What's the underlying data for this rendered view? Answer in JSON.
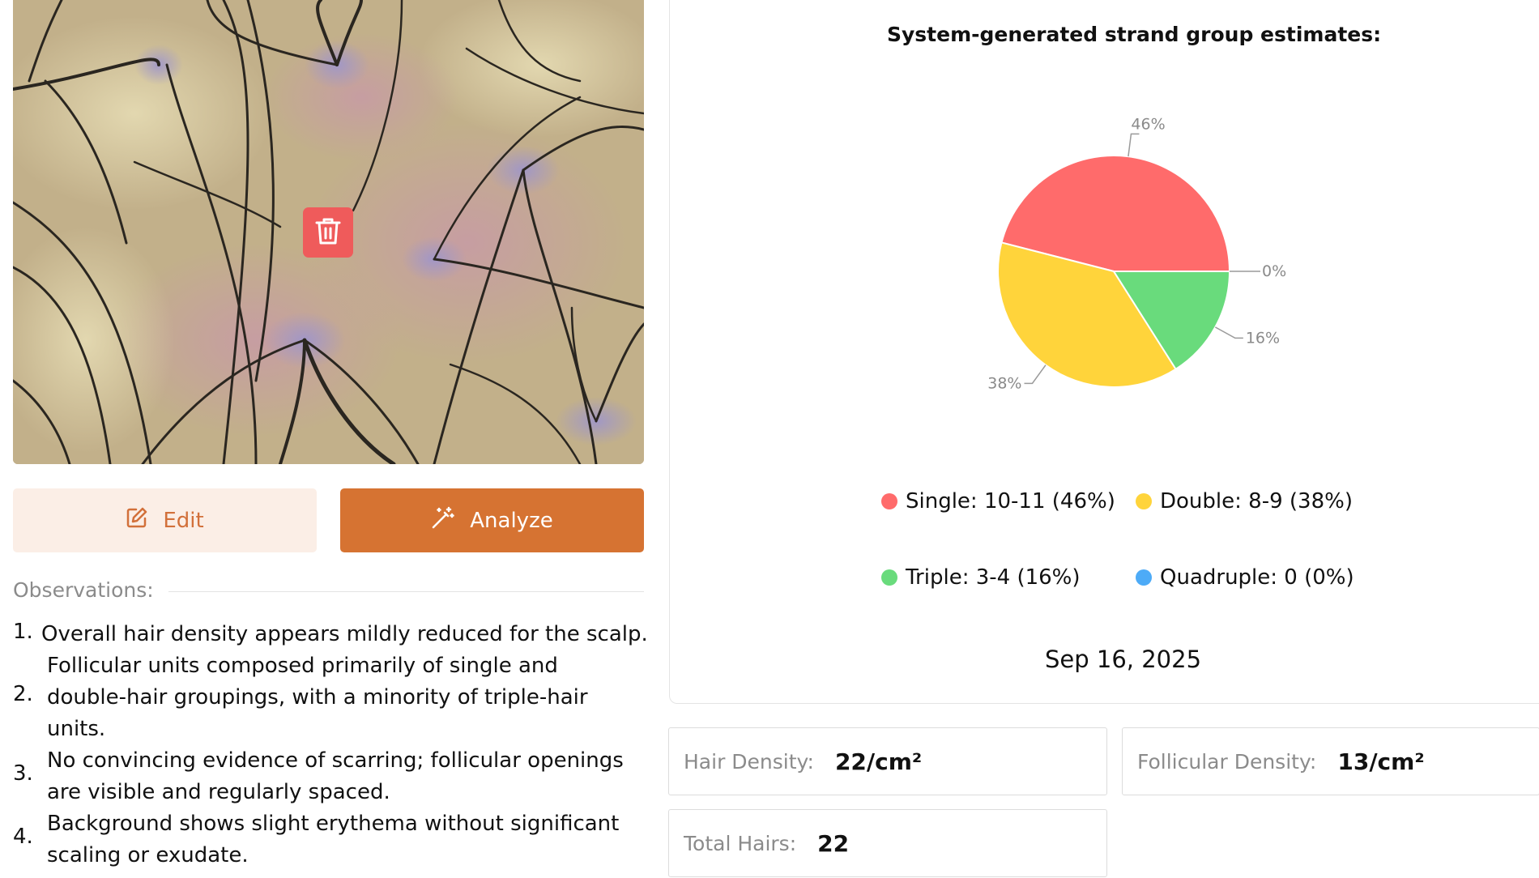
{
  "actions": {
    "edit_label": "Edit",
    "analyze_label": "Analyze"
  },
  "observations": {
    "heading": "Observations:",
    "items": [
      {
        "num": "1.",
        "lines": [
          "Overall hair density appears mildly reduced for the scalp."
        ]
      },
      {
        "num": "2.",
        "lines": [
          "Follicular units composed primarily of single and",
          "double-hair groupings, with a minority of triple-hair",
          "units."
        ]
      },
      {
        "num": "3.",
        "lines": [
          "No convincing evidence of scarring; follicular openings",
          "are visible and regularly spaced."
        ]
      },
      {
        "num": "4.",
        "lines": [
          "Background shows slight erythema without significant",
          "scaling or exudate."
        ]
      }
    ]
  },
  "chart_data": {
    "type": "pie",
    "title": "System-generated strand group estimates:",
    "slices": [
      {
        "name": "Single",
        "range": "10-11",
        "percent": 46,
        "label": "46%",
        "color": "#ff6b6b"
      },
      {
        "name": "Double",
        "range": "8-9",
        "percent": 38,
        "label": "38%",
        "color": "#ffd43b"
      },
      {
        "name": "Triple",
        "range": "3-4",
        "percent": 16,
        "label": "16%",
        "color": "#69db7c"
      },
      {
        "name": "Quadruple",
        "range": "0",
        "percent": 0,
        "label": "0%",
        "color": "#4dabf7"
      }
    ],
    "legend": [
      "Single: 10-11 (46%)",
      "Double: 8-9 (38%)",
      "Triple: 3-4 (16%)",
      "Quadruple: 0 (0%)"
    ],
    "legend_position": "bottom"
  },
  "date": "Sep 16, 2025",
  "stats": {
    "hair_density_label": "Hair Density:",
    "hair_density_value": "22/cm²",
    "follicular_density_label": "Follicular Density:",
    "follicular_density_value": "13/cm²",
    "total_hairs_label": "Total Hairs:",
    "total_hairs_value": "22"
  },
  "icons": {
    "delete": "trash-icon",
    "edit": "edit-icon",
    "analyze": "magic-wand-icon"
  },
  "colors": {
    "accent": "#d67332",
    "accent_light": "#fbeee6",
    "danger": "#ef5b5b"
  }
}
